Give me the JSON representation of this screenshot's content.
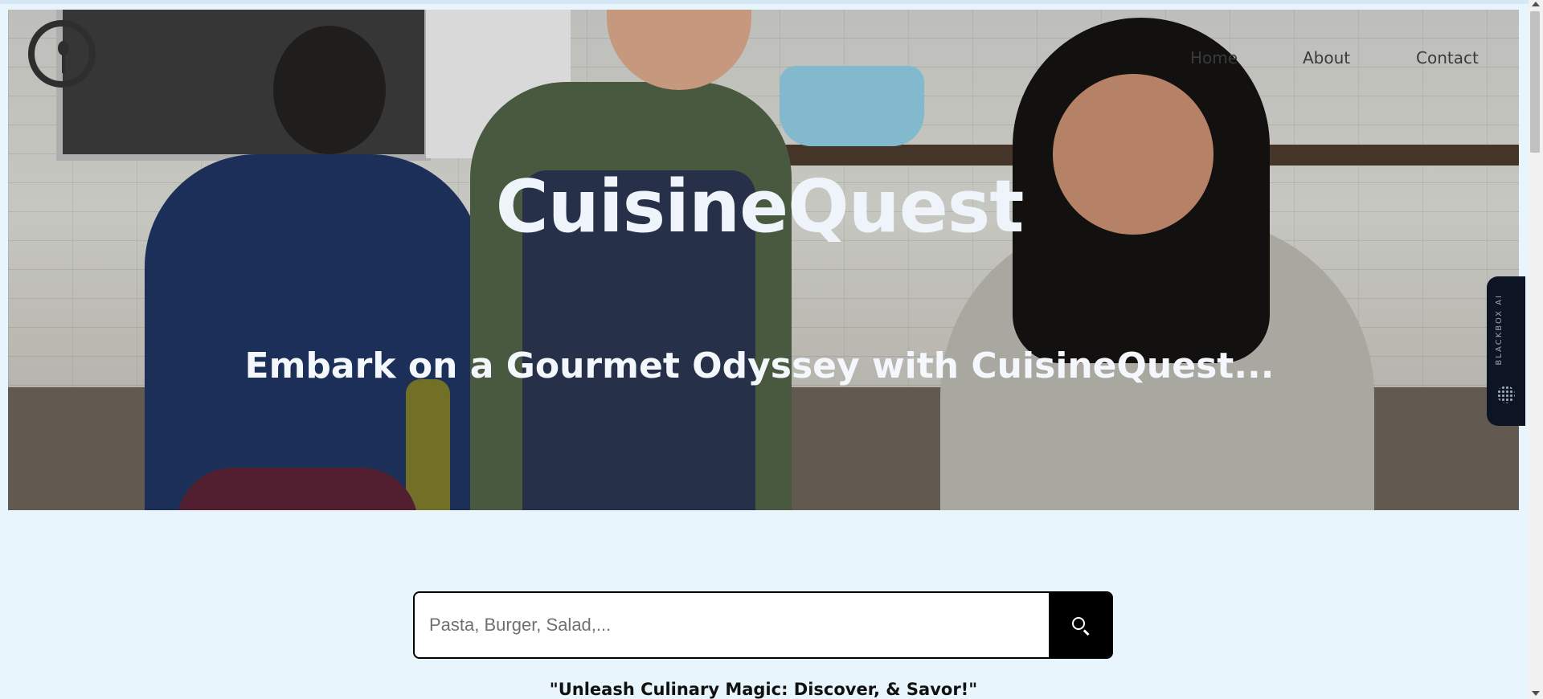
{
  "brand": {
    "title": "CuisineQuest"
  },
  "nav": {
    "home": "Home",
    "about": "About",
    "contact": "Contact"
  },
  "hero": {
    "subtitle": "Embark on a Gourmet Odyssey with CuisineQuest..."
  },
  "search": {
    "placeholder": "Pasta, Burger, Salad,...",
    "value": ""
  },
  "tagline": "\"Unleash Culinary Magic: Discover, & Savor!\"",
  "side_widget": {
    "label": "BLACKBOX AI"
  },
  "icons": {
    "logo": "spoon-logo-icon",
    "search": "search-icon",
    "widget": "dots-icon"
  },
  "colors": {
    "page_bg": "#e8f5fc",
    "search_button": "#000000",
    "title": "#eef4fa"
  }
}
